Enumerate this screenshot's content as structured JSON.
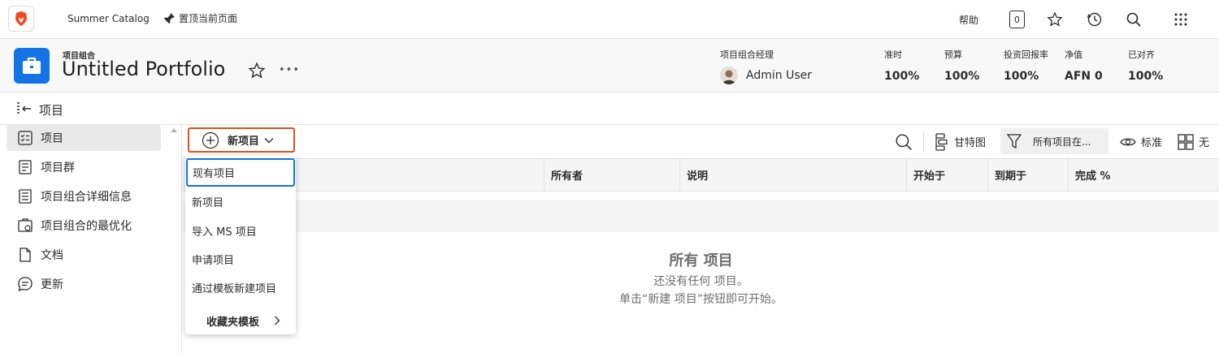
{
  "topbar": {
    "catalog_label": "Summer Catalog",
    "pin_label": "置顶当前页面",
    "help_label": "帮助",
    "notification_count": "0"
  },
  "header": {
    "breadcrumb": "项目组合",
    "title": "Untitled Portfolio",
    "more_label": "•••",
    "manager_label": "项目组合经理",
    "manager_name": "Admin User",
    "metrics": [
      {
        "label": "准时",
        "value": "100%"
      },
      {
        "label": "预算",
        "value": "100%"
      },
      {
        "label": "投资回报率",
        "value": "100%"
      },
      {
        "label": "净值",
        "value": "AFN 0"
      },
      {
        "label": "已对齐",
        "value": "100%"
      }
    ]
  },
  "nav": {
    "section_title": "项目"
  },
  "sidebar": {
    "items": [
      {
        "label": "项目"
      },
      {
        "label": "项目群"
      },
      {
        "label": "项目组合详细信息"
      },
      {
        "label": "项目组合的最优化"
      },
      {
        "label": "文档"
      },
      {
        "label": "更新"
      }
    ]
  },
  "toolbar": {
    "new_button_label": "新项目",
    "gantt_label": "甘特图",
    "filter_label": "所有项目在...",
    "view_label": "标准",
    "group_label": "无"
  },
  "table": {
    "columns": [
      "所有者",
      "说明",
      "开始于",
      "到期于",
      "完成 %"
    ]
  },
  "dropdown": {
    "items": [
      "现有项目",
      "新项目",
      "导入 MS 项目",
      "申请项目",
      "通过模板新建项目"
    ],
    "favorites_label": "收藏夹模板"
  },
  "empty_state": {
    "title": "所有 项目",
    "line1": "还没有任何 项目。",
    "line2": "单击“新建 项目”按钮即可开始。"
  },
  "colors": {
    "accent_blue": "#1473e6",
    "highlight_orange": "#d9531e",
    "logo_orange": "#f04a23"
  }
}
